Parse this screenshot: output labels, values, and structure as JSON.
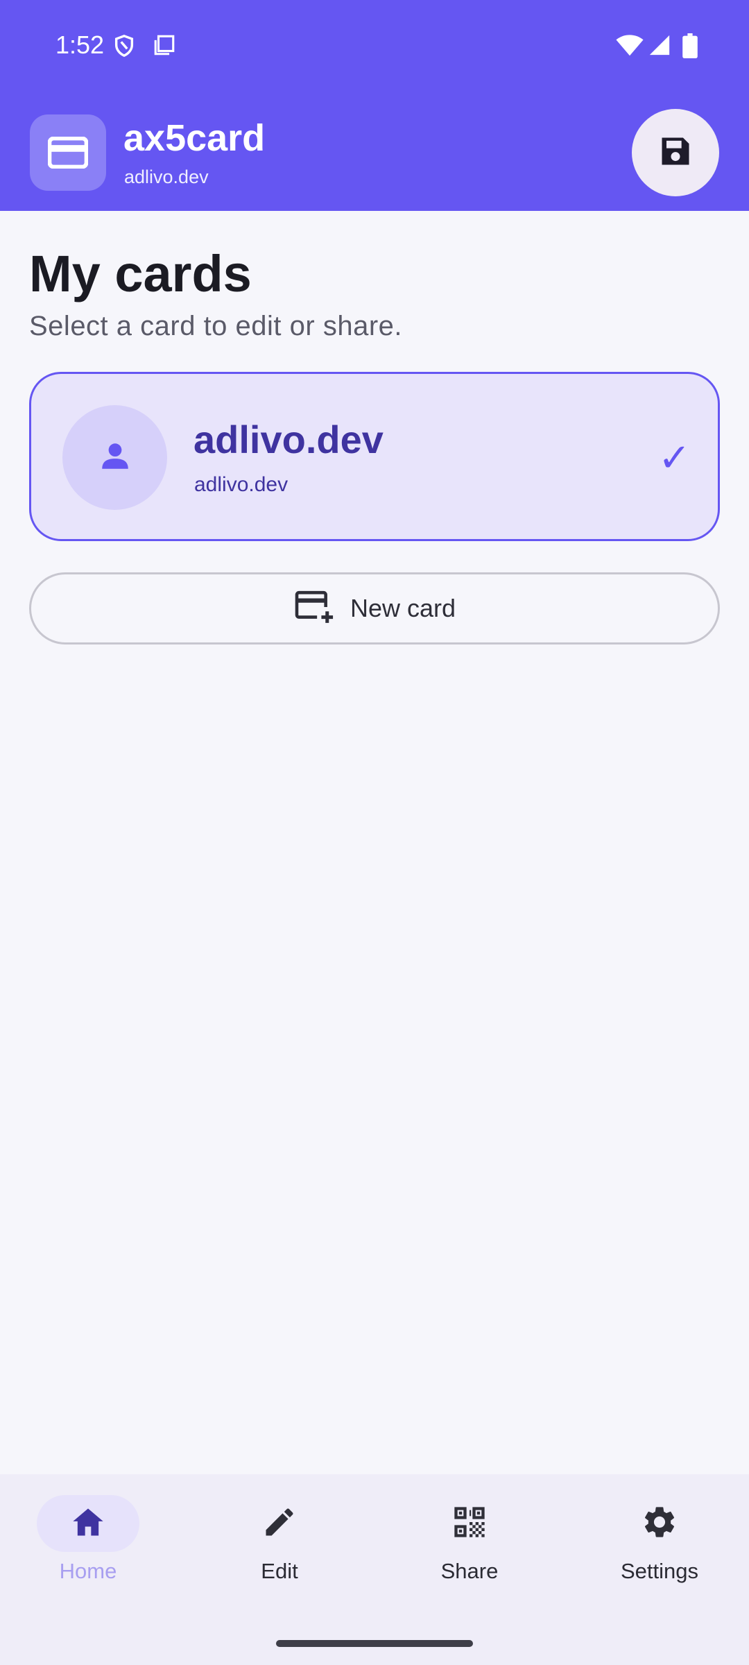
{
  "status_bar": {
    "time": "1:52",
    "icons": [
      "shield-icon",
      "screenshot-icon",
      "wifi-icon",
      "signal-icon",
      "battery-icon"
    ]
  },
  "app_bar": {
    "title": "ax5card",
    "subtitle": "adlivo.dev",
    "app_icon": "credit-card-icon",
    "action_icon": "save-icon"
  },
  "main": {
    "heading": "My cards",
    "subheading": "Select a card to edit or share.",
    "cards": [
      {
        "title": "adlivo.dev",
        "subtitle": "adlivo.dev",
        "selected": true,
        "check": "✓"
      }
    ],
    "new_card_label": "New card"
  },
  "nav": {
    "items": [
      {
        "label": "Home",
        "icon": "home-icon",
        "active": true
      },
      {
        "label": "Edit",
        "icon": "pencil-icon",
        "active": false
      },
      {
        "label": "Share",
        "icon": "qr-code-icon",
        "active": false
      },
      {
        "label": "Settings",
        "icon": "gear-icon",
        "active": false
      }
    ]
  },
  "colors": {
    "primary": "#6556f2",
    "card_bg": "#e8e4fb",
    "card_text": "#3f33a0",
    "background": "#f6f6fb"
  }
}
